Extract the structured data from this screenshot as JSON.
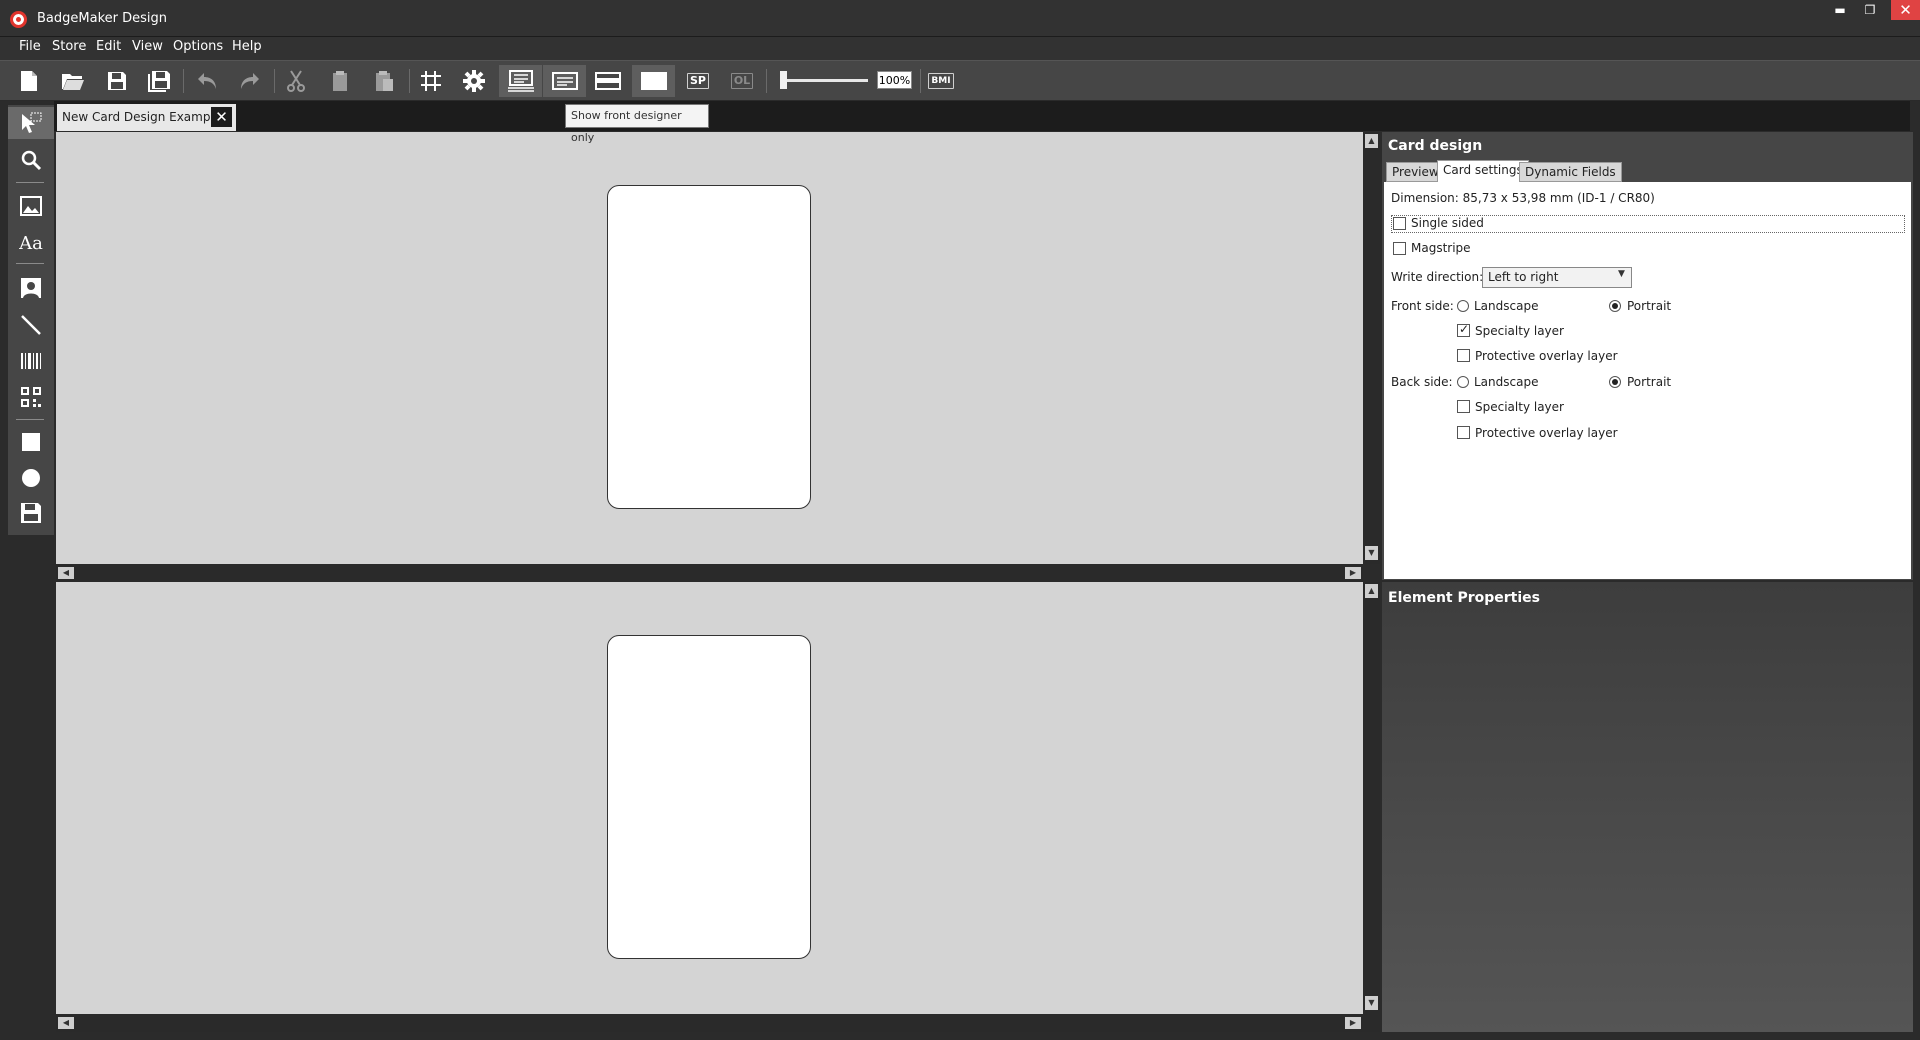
{
  "window": {
    "title": "BadgeMaker Design",
    "min_glyph": "▬",
    "restore_glyph": "❐",
    "close_glyph": "✕"
  },
  "menu": [
    "File",
    "Store",
    "Edit",
    "View",
    "Options",
    "Help"
  ],
  "toolbar": {
    "zoom": "100%",
    "sp_label": "SP",
    "ol_label": "OL",
    "bmi_label": "BMI"
  },
  "document_tab": {
    "label": "New Card Design Example",
    "close_glyph": "✕"
  },
  "tooltip": "Show front designer only",
  "left_tools": {
    "text_tool": "Aa"
  },
  "card_design": {
    "title": "Card design",
    "tabs": [
      "Preview",
      "Card settings",
      "Dynamic Fields"
    ],
    "active_tab": "Card settings",
    "dimension": "Dimension: 85,73 x 53,98 mm (ID-1 / CR80)",
    "single_sided": {
      "label": "Single sided",
      "checked": false
    },
    "magstripe": {
      "label": "Magstripe",
      "checked": false
    },
    "write_direction": {
      "label": "Write direction:",
      "value": "Left to right"
    },
    "front_side": {
      "label": "Front side:",
      "landscape": "Landscape",
      "portrait": "Portrait",
      "orientation": "Portrait",
      "specialty_layer": {
        "label": "Specialty layer",
        "checked": true
      },
      "protective_overlay": {
        "label": "Protective overlay layer",
        "checked": false
      }
    },
    "back_side": {
      "label": "Back side:",
      "landscape": "Landscape",
      "portrait": "Portrait",
      "orientation": "Portrait",
      "specialty_layer": {
        "label": "Specialty layer",
        "checked": false
      },
      "protective_overlay": {
        "label": "Protective overlay layer",
        "checked": false
      }
    }
  },
  "element_properties": {
    "title": "Element Properties"
  },
  "colors": {
    "close_red": "#e04343",
    "logo_red": "#e0342d",
    "canvas_bg": "#d4d4d4",
    "panel_bg": "#464646"
  }
}
